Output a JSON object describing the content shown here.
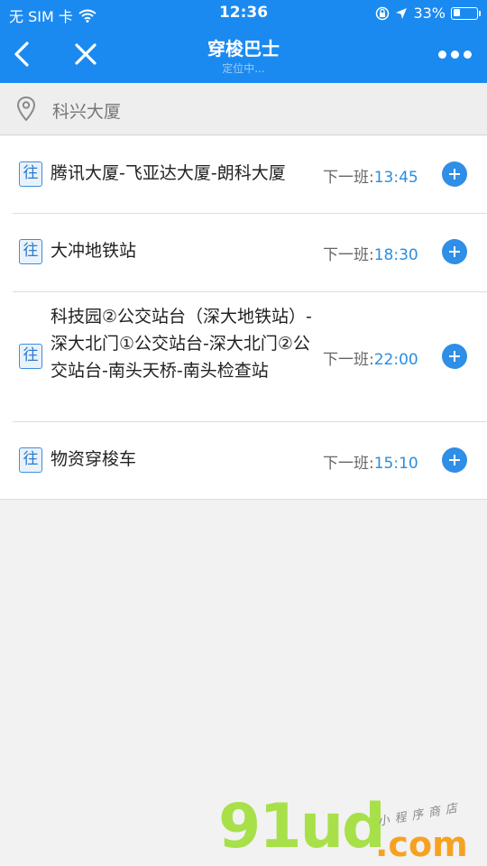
{
  "status_bar": {
    "carrier": "无 SIM 卡",
    "time": "12:36",
    "battery_percent": "33%",
    "battery_level": 0.33,
    "icons": [
      "wifi-icon",
      "orientation-lock-icon",
      "location-arrow-icon",
      "battery-icon"
    ]
  },
  "nav": {
    "title": "穿梭巴士",
    "subtitle": "定位中...",
    "icons": [
      "back-chevron-icon",
      "close-icon",
      "more-icon"
    ]
  },
  "location": {
    "text": "科兴大厦",
    "icon": "map-pin-icon"
  },
  "routes": [
    {
      "badge": "往",
      "name": "腾讯大厦-飞亚达大厦-朗科大厦",
      "next_label": "下一班:",
      "next_time": "13:45"
    },
    {
      "badge": "往",
      "name": "大冲地铁站",
      "next_label": "下一班:",
      "next_time": "18:30"
    },
    {
      "badge": "往",
      "name": "科技园②公交站台（深大地铁站）-深大北门①公交站台-深大北门②公交站台-南头天桥-南头检查站",
      "next_label": "下一班:",
      "next_time": "22:00"
    },
    {
      "badge": "往",
      "name": "物资穿梭车",
      "next_label": "下一班:",
      "next_time": "15:10"
    }
  ],
  "watermark": {
    "main": "91ud",
    "dotcom": ".com",
    "tagline": "小程序商店"
  },
  "colors": {
    "primary": "#1b8af0",
    "accent_time": "#2a8de0",
    "background": "#f2f2f2"
  }
}
